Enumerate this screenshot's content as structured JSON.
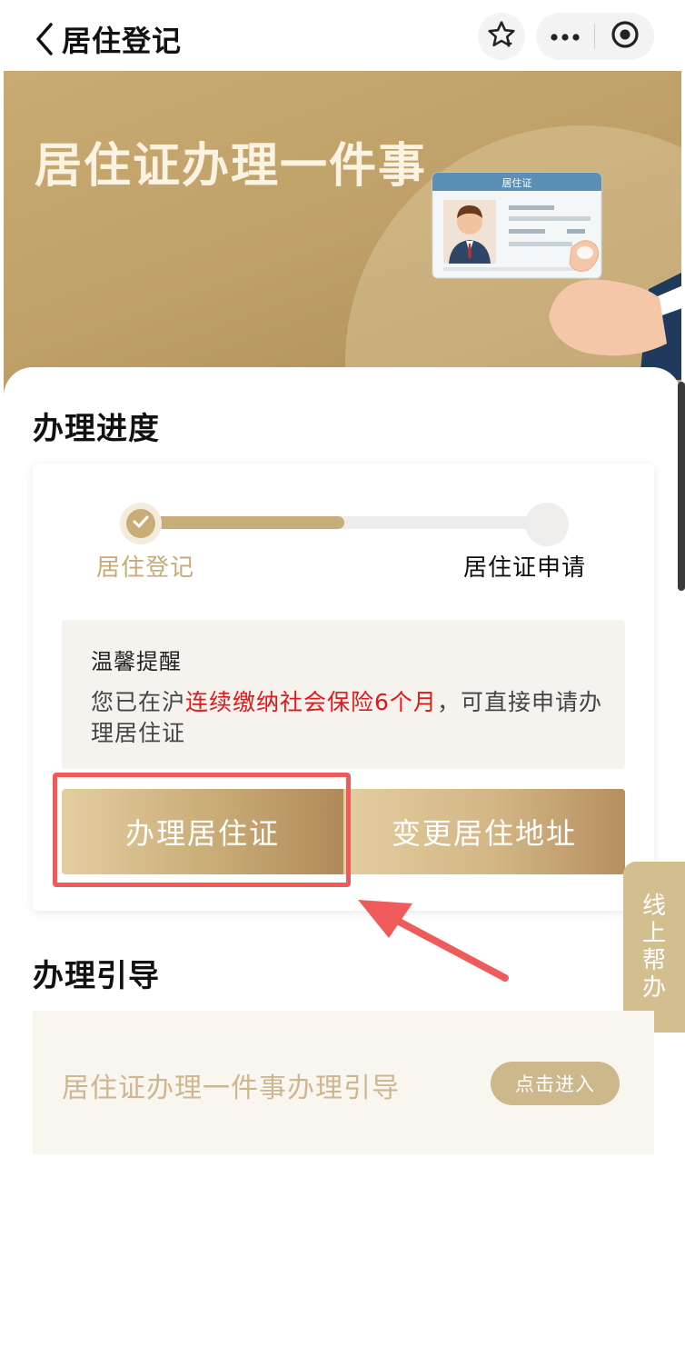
{
  "nav": {
    "back_icon": "chevron-left-icon",
    "title": "居住登记",
    "star_icon": "star-icon",
    "more_icon": "more-dots-icon",
    "target_icon": "record-target-icon"
  },
  "banner": {
    "title": "居住证办理一件事",
    "card_label": "居住证"
  },
  "progress": {
    "section_title": "办理进度",
    "fill_ratio": 0.5,
    "steps": [
      {
        "label": "居住登记",
        "status": "done"
      },
      {
        "label": "居住证申请",
        "status": "pending"
      }
    ],
    "tip": {
      "title": "温馨提醒",
      "text_prefix": "您已在沪",
      "text_highlight": "连续缴纳社会保险6个月",
      "text_suffix": "，可直接申请办理居住证"
    },
    "buttons": {
      "apply": "办理居住证",
      "change": "变更居住地址"
    }
  },
  "float_help": {
    "label": "线上帮办"
  },
  "guide": {
    "section_title": "办理引导",
    "item_text": "居住证办理一件事办理引导",
    "enter_label": "点击进入"
  },
  "colors": {
    "accent_gold": "#c7ab77",
    "highlight_red": "#e0181b",
    "annotation_red": "#ef5b5b"
  }
}
